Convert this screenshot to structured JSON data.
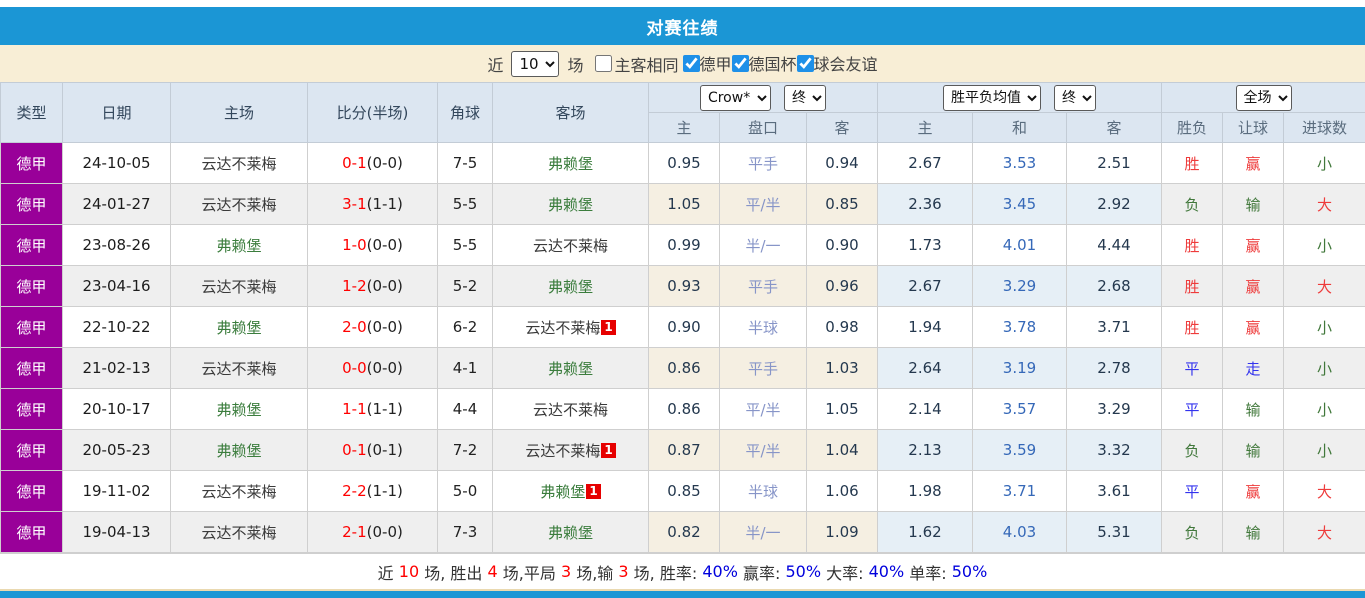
{
  "title": "对赛往绩",
  "colors": {
    "title_bar": "#1b96d5",
    "filter_bg": "#f8eed6",
    "header_bg": "#dce6f1",
    "league_badge": "#990099",
    "team_highlight": "#3b7d3d",
    "score_red": "#ff0000",
    "red_card_badge": "#e60000",
    "odds_bg": "#fdf8ef",
    "avg_bg": "#edf6fb",
    "result_win": "#ee3b3b",
    "result_draw": "#3333ee",
    "result_lose": "#41783b",
    "summary_pct": "#0000dd"
  },
  "filter": {
    "near_label": "近",
    "count_value": "10",
    "games_label": "场",
    "same_venue_label": "主客相同",
    "same_venue_checked": false,
    "leagues": [
      {
        "label": "德甲",
        "checked": true
      },
      {
        "label": "德国杯",
        "checked": true
      },
      {
        "label": "球会友谊",
        "checked": true
      }
    ]
  },
  "table": {
    "headers": {
      "type": "类型",
      "date": "日期",
      "home": "主场",
      "score": "比分(半场)",
      "corner": "角球",
      "away": "客场",
      "odds_company": "Crow*",
      "odds_stage": "终",
      "odds_home": "主",
      "odds_handicap": "盘口",
      "odds_away": "客",
      "avg_name": "胜平负均值",
      "avg_stage": "终",
      "avg_home": "主",
      "avg_draw": "和",
      "avg_away": "客",
      "scope": "全场",
      "result": "胜负",
      "handicap_result": "让球",
      "goals": "进球数"
    },
    "rows": [
      {
        "type": "德甲",
        "date": "24-10-05",
        "home": "云达不莱梅",
        "home_hl": false,
        "score": "0-1",
        "half": "(0-0)",
        "corners": "7-5",
        "away": "弗赖堡",
        "away_hl": true,
        "odds_home": "0.95",
        "handicap": "平手",
        "odds_away": "0.94",
        "avg_home": "2.67",
        "avg_draw": "3.53",
        "avg_away": "2.51",
        "result": "胜",
        "result_color": "red",
        "handicap_res": "赢",
        "handicap_res_color": "red",
        "goals": "小",
        "goals_color": "green"
      },
      {
        "type": "德甲",
        "date": "24-01-27",
        "home": "云达不莱梅",
        "home_hl": false,
        "score": "3-1",
        "half": "(1-1)",
        "corners": "5-5",
        "away": "弗赖堡",
        "away_hl": true,
        "odds_home": "1.05",
        "handicap": "平/半",
        "odds_away": "0.85",
        "avg_home": "2.36",
        "avg_draw": "3.45",
        "avg_away": "2.92",
        "result": "负",
        "result_color": "green",
        "handicap_res": "输",
        "handicap_res_color": "green",
        "goals": "大",
        "goals_color": "red"
      },
      {
        "type": "德甲",
        "date": "23-08-26",
        "home": "弗赖堡",
        "home_hl": true,
        "score": "1-0",
        "half": "(0-0)",
        "corners": "5-5",
        "away": "云达不莱梅",
        "away_hl": false,
        "odds_home": "0.99",
        "handicap": "半/一",
        "odds_away": "0.90",
        "avg_home": "1.73",
        "avg_draw": "4.01",
        "avg_away": "4.44",
        "result": "胜",
        "result_color": "red",
        "handicap_res": "赢",
        "handicap_res_color": "red",
        "goals": "小",
        "goals_color": "green"
      },
      {
        "type": "德甲",
        "date": "23-04-16",
        "home": "云达不莱梅",
        "home_hl": false,
        "score": "1-2",
        "half": "(0-0)",
        "corners": "5-2",
        "away": "弗赖堡",
        "away_hl": true,
        "odds_home": "0.93",
        "handicap": "平手",
        "odds_away": "0.96",
        "avg_home": "2.67",
        "avg_draw": "3.29",
        "avg_away": "2.68",
        "result": "胜",
        "result_color": "red",
        "handicap_res": "赢",
        "handicap_res_color": "red",
        "goals": "大",
        "goals_color": "red"
      },
      {
        "type": "德甲",
        "date": "22-10-22",
        "home": "弗赖堡",
        "home_hl": true,
        "score": "2-0",
        "half": "(0-0)",
        "corners": "6-2",
        "away": "云达不莱梅",
        "away_hl": false,
        "away_badge": "1",
        "odds_home": "0.90",
        "handicap": "半球",
        "odds_away": "0.98",
        "avg_home": "1.94",
        "avg_draw": "3.78",
        "avg_away": "3.71",
        "result": "胜",
        "result_color": "red",
        "handicap_res": "赢",
        "handicap_res_color": "red",
        "goals": "小",
        "goals_color": "green"
      },
      {
        "type": "德甲",
        "date": "21-02-13",
        "home": "云达不莱梅",
        "home_hl": false,
        "score": "0-0",
        "half": "(0-0)",
        "corners": "4-1",
        "away": "弗赖堡",
        "away_hl": true,
        "odds_home": "0.86",
        "handicap": "平手",
        "odds_away": "1.03",
        "avg_home": "2.64",
        "avg_draw": "3.19",
        "avg_away": "2.78",
        "result": "平",
        "result_color": "blue",
        "handicap_res": "走",
        "handicap_res_color": "blue",
        "goals": "小",
        "goals_color": "green"
      },
      {
        "type": "德甲",
        "date": "20-10-17",
        "home": "弗赖堡",
        "home_hl": true,
        "score": "1-1",
        "half": "(1-1)",
        "corners": "4-4",
        "away": "云达不莱梅",
        "away_hl": false,
        "odds_home": "0.86",
        "handicap": "平/半",
        "odds_away": "1.05",
        "avg_home": "2.14",
        "avg_draw": "3.57",
        "avg_away": "3.29",
        "result": "平",
        "result_color": "blue",
        "handicap_res": "输",
        "handicap_res_color": "green",
        "goals": "小",
        "goals_color": "green"
      },
      {
        "type": "德甲",
        "date": "20-05-23",
        "home": "弗赖堡",
        "home_hl": true,
        "score": "0-1",
        "half": "(0-1)",
        "corners": "7-2",
        "away": "云达不莱梅",
        "away_hl": false,
        "away_badge": "1",
        "odds_home": "0.87",
        "handicap": "平/半",
        "odds_away": "1.04",
        "avg_home": "2.13",
        "avg_draw": "3.59",
        "avg_away": "3.32",
        "result": "负",
        "result_color": "green",
        "handicap_res": "输",
        "handicap_res_color": "green",
        "goals": "小",
        "goals_color": "green"
      },
      {
        "type": "德甲",
        "date": "19-11-02",
        "home": "云达不莱梅",
        "home_hl": false,
        "score": "2-2",
        "half": "(1-1)",
        "corners": "5-0",
        "away": "弗赖堡",
        "away_hl": true,
        "away_badge": "1",
        "odds_home": "0.85",
        "handicap": "半球",
        "odds_away": "1.06",
        "avg_home": "1.98",
        "avg_draw": "3.71",
        "avg_away": "3.61",
        "result": "平",
        "result_color": "blue",
        "handicap_res": "赢",
        "handicap_res_color": "red",
        "goals": "大",
        "goals_color": "red"
      },
      {
        "type": "德甲",
        "date": "19-04-13",
        "home": "云达不莱梅",
        "home_hl": false,
        "score": "2-1",
        "half": "(0-0)",
        "corners": "7-3",
        "away": "弗赖堡",
        "away_hl": true,
        "odds_home": "0.82",
        "handicap": "半/一",
        "odds_away": "1.09",
        "avg_home": "1.62",
        "avg_draw": "4.03",
        "avg_away": "5.31",
        "result": "负",
        "result_color": "green",
        "handicap_res": "输",
        "handicap_res_color": "green",
        "goals": "大",
        "goals_color": "red"
      }
    ]
  },
  "summary": {
    "segments": [
      {
        "t": "近 ",
        "c": "dark"
      },
      {
        "t": "10",
        "c": "red"
      },
      {
        "t": " 场, 胜出 ",
        "c": "dark"
      },
      {
        "t": "4",
        "c": "red"
      },
      {
        "t": " 场,平局 ",
        "c": "dark"
      },
      {
        "t": "3",
        "c": "red"
      },
      {
        "t": " 场,输 ",
        "c": "dark"
      },
      {
        "t": "3",
        "c": "red"
      },
      {
        "t": " 场, 胜率: ",
        "c": "dark"
      },
      {
        "t": "40%",
        "c": "blue"
      },
      {
        "t": " 赢率: ",
        "c": "dark"
      },
      {
        "t": "50%",
        "c": "blue"
      },
      {
        "t": " 大率: ",
        "c": "dark"
      },
      {
        "t": "40%",
        "c": "blue"
      },
      {
        "t": " 单率: ",
        "c": "dark"
      },
      {
        "t": "50%",
        "c": "blue"
      }
    ]
  }
}
